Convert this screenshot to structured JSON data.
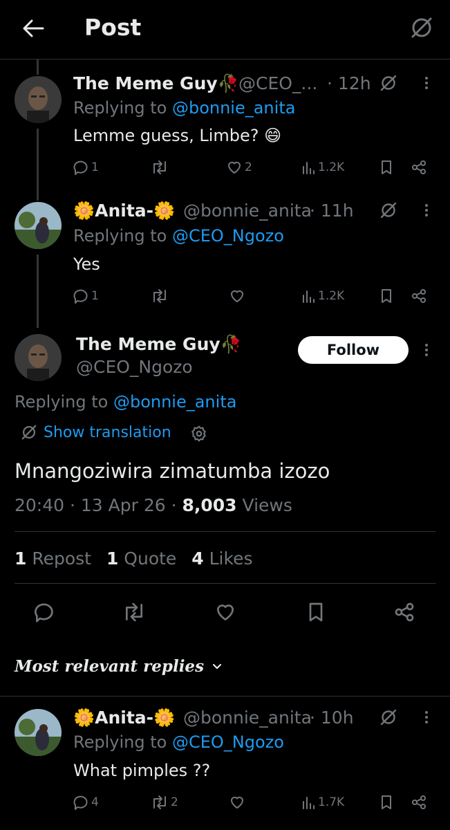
{
  "header": {
    "title": "Post"
  },
  "replies_above": [
    {
      "name": "The Meme Guy🥀",
      "handle": "@CEO_...",
      "time": "· 12h",
      "replying_prefix": "Replying to",
      "replying_to": "@bonnie_anita",
      "text": "Lemme guess, Limbe? 😄",
      "stats": {
        "replies": "1",
        "reposts": "",
        "likes": "2",
        "views": "1.2K"
      }
    },
    {
      "name": "🌼Anita-🌼",
      "handle": "@bonnie_anita",
      "time": "· 11h",
      "replying_prefix": "Replying to",
      "replying_to": "@CEO_Ngozo",
      "text": "Yes",
      "stats": {
        "replies": "1",
        "reposts": "",
        "likes": "",
        "views": "1.2K"
      }
    }
  ],
  "main_post": {
    "name": "The Meme Guy🥀",
    "handle": "@CEO_Ngozo",
    "follow_label": "Follow",
    "replying_prefix": "Replying to",
    "replying_to": "@bonnie_anita",
    "translation_label": "Show translation",
    "text": "Mnangoziwira zimatumba izozo",
    "time": "20:40 · 13 Apr 26 ·",
    "views_count": "8,003",
    "views_label": "Views",
    "engagement": [
      {
        "count": "1",
        "label": "Repost"
      },
      {
        "count": "1",
        "label": "Quote"
      },
      {
        "count": "4",
        "label": "Likes"
      }
    ]
  },
  "sort": {
    "label": "Most relevant replies"
  },
  "replies_below": [
    {
      "name": "🌼Anita-🌼",
      "handle": "@bonnie_anita",
      "time": "· 10h",
      "replying_prefix": "Replying to",
      "replying_to": "@CEO_Ngozo",
      "text": "What pimples ??",
      "stats": {
        "replies": "4",
        "reposts": "2",
        "likes": "",
        "views": "1.7K"
      }
    }
  ],
  "colors": {
    "background": "#000000",
    "accent": "#1d9bf0",
    "muted": "#71767b",
    "text": "#e7e9ea",
    "follow_bg": "#ffffff"
  }
}
